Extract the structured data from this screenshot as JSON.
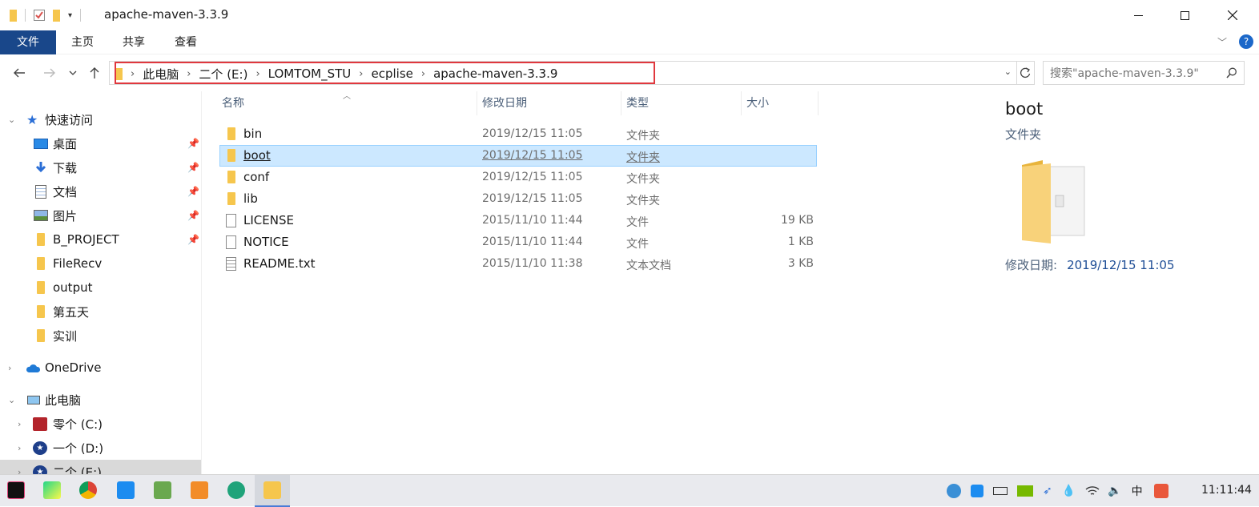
{
  "window": {
    "title": "apache-maven-3.3.9"
  },
  "ribbon": {
    "tabs": [
      "文件",
      "主页",
      "共享",
      "查看"
    ]
  },
  "address": {
    "crumbs": [
      "此电脑",
      "二个 (E:)",
      "LOMTOM_STU",
      "ecplise",
      "apache-maven-3.3.9"
    ]
  },
  "search": {
    "placeholder": "搜索\"apache-maven-3.3.9\""
  },
  "sidebar": {
    "quick_access": "快速访问",
    "items": [
      {
        "label": "桌面",
        "icon": "desktop-icon",
        "pinned": true
      },
      {
        "label": "下载",
        "icon": "download-icon",
        "pinned": true
      },
      {
        "label": "文档",
        "icon": "document-icon",
        "pinned": true
      },
      {
        "label": "图片",
        "icon": "picture-icon",
        "pinned": true
      },
      {
        "label": "B_PROJECT",
        "icon": "folder-icon",
        "pinned": true
      },
      {
        "label": "FileRecv",
        "icon": "folder-icon",
        "pinned": false
      },
      {
        "label": "output",
        "icon": "folder-icon",
        "pinned": false
      },
      {
        "label": "第五天",
        "icon": "folder-icon",
        "pinned": false
      },
      {
        "label": "实训",
        "icon": "folder-icon",
        "pinned": false
      }
    ],
    "onedrive": "OneDrive",
    "this_pc": "此电脑",
    "drives": [
      {
        "label": "零个 (C:)"
      },
      {
        "label": "一个 (D:)"
      },
      {
        "label": "二个 (E:)"
      }
    ]
  },
  "columns": {
    "name": "名称",
    "modified": "修改日期",
    "type": "类型",
    "size": "大小"
  },
  "files": [
    {
      "name": "bin",
      "modified": "2019/12/15 11:05",
      "type": "文件夹",
      "size": "",
      "kind": "folder"
    },
    {
      "name": "boot",
      "modified": "2019/12/15 11:05",
      "type": "文件夹",
      "size": "",
      "kind": "folder",
      "selected": true
    },
    {
      "name": "conf",
      "modified": "2019/12/15 11:05",
      "type": "文件夹",
      "size": "",
      "kind": "folder"
    },
    {
      "name": "lib",
      "modified": "2019/12/15 11:05",
      "type": "文件夹",
      "size": "",
      "kind": "folder"
    },
    {
      "name": "LICENSE",
      "modified": "2015/11/10 11:44",
      "type": "文件",
      "size": "19 KB",
      "kind": "file"
    },
    {
      "name": "NOTICE",
      "modified": "2015/11/10 11:44",
      "type": "文件",
      "size": "1 KB",
      "kind": "file"
    },
    {
      "name": "README.txt",
      "modified": "2015/11/10 11:38",
      "type": "文本文档",
      "size": "3 KB",
      "kind": "text"
    }
  ],
  "preview": {
    "name": "boot",
    "type": "文件夹",
    "modified_label": "修改日期:",
    "modified_value": "2019/12/15 11:05"
  },
  "taskbar": {
    "clock": "11:11:44",
    "ime": "中"
  },
  "colors": {
    "file_tab": "#19478a",
    "selection": "#cce8ff",
    "highlight_box": "#e0383e",
    "folder": "#f6c64d"
  }
}
